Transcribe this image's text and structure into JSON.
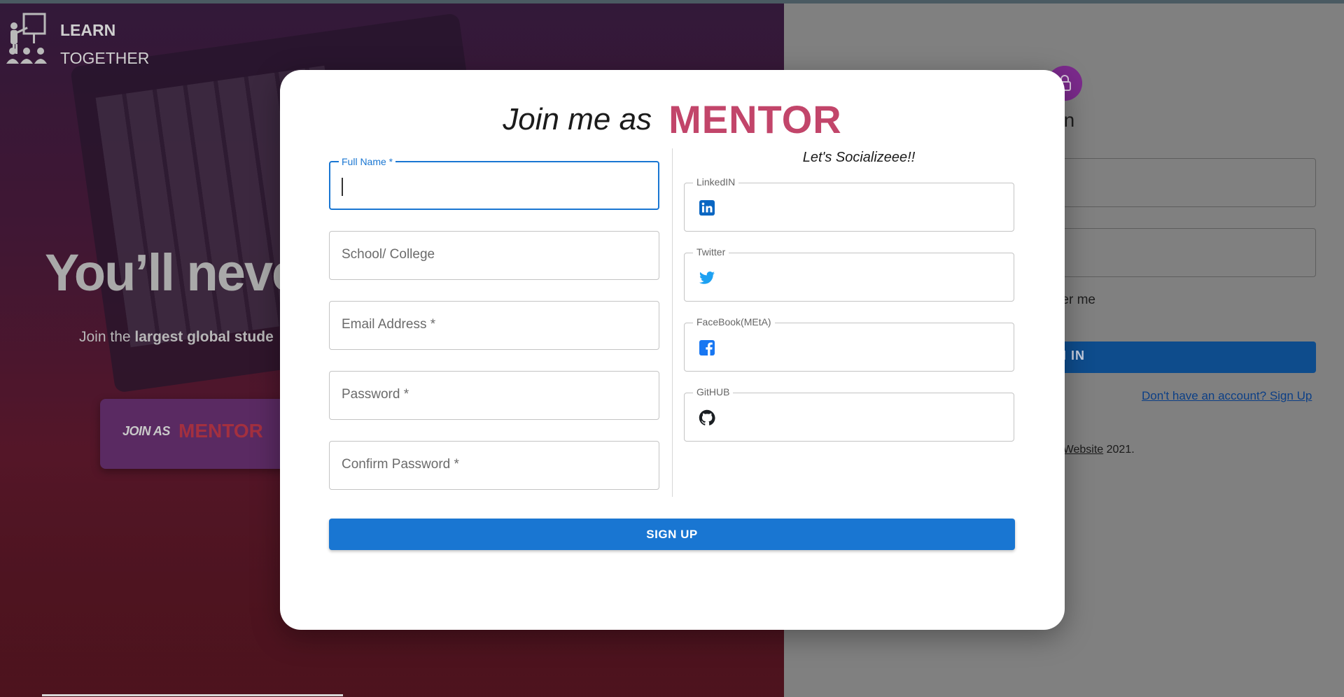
{
  "brand": {
    "line1": "LEARN",
    "line2": "TOGETHER"
  },
  "hero": {
    "headline": "You’ll neve",
    "sub_pre": "Join the ",
    "sub_bold": "largest global stude",
    "join_label": "JOIN AS",
    "join_accent": "MENTOR"
  },
  "signin": {
    "title": "n in",
    "remember": "mber me",
    "button": "N IN",
    "signup_link": "Don't have an account? Sign Up",
    "copyright_link": "ur Website",
    "copyright_year": " 2021."
  },
  "modal": {
    "title_pre": "Join me as",
    "title_accent": "MENTOR",
    "fields": {
      "full_name_label": "Full Name *",
      "school": "School/ College",
      "email": "Email Address *",
      "password": "Password *",
      "confirm_password": "Confirm Password *"
    },
    "social_title": "Let's Socializeee!!",
    "social": {
      "linkedin": "LinkedIN",
      "twitter": "Twitter",
      "facebook": "FaceBook(MEtA)",
      "github": "GitHUB"
    },
    "signup_button": "SIGN UP"
  },
  "colors": {
    "primary": "#1976d2",
    "accent": "#c2456a",
    "linkedin": "#0a66c2",
    "twitter": "#1da1f2",
    "facebook": "#1877f2",
    "github": "#1b1f23"
  },
  "icons": [
    "presentation-logo-icon",
    "lock-icon",
    "linkedin-icon",
    "twitter-icon",
    "facebook-icon",
    "github-icon"
  ]
}
